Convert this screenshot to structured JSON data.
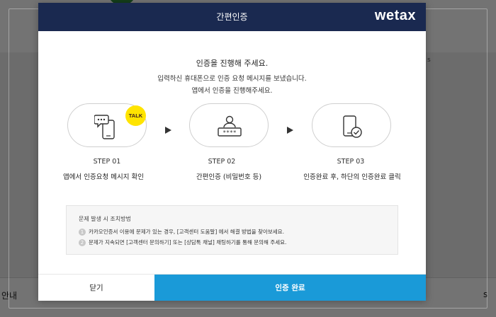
{
  "background": {
    "side_text": "s",
    "bottom_left_text": "안내",
    "bottom_right_text": "s"
  },
  "modal": {
    "title": "간편인증",
    "logo": "wetax",
    "heading": "인증을 진행해 주세요.",
    "description_line1": "입력하신 휴대폰으로 인증 요청 메시지를 보냈습니다.",
    "description_line2": "앱에서 인증을 진행해주세요."
  },
  "steps": [
    {
      "label": "STEP 01",
      "description": "앱에서 인증요청 메시지 확인",
      "icon": "phone-message-icon",
      "badge": "TALK"
    },
    {
      "label": "STEP 02",
      "description": "간편인증 (비밀번호 등)",
      "icon": "password-user-icon"
    },
    {
      "label": "STEP 03",
      "description": "인증완료 후, 하단의 인증완료 클릭",
      "icon": "phone-check-icon"
    }
  ],
  "info": {
    "title": "문제 발생 시 조치방법",
    "items": [
      {
        "num": "1",
        "text": "카카오인증서 이용에 문제가 있는 경우, [고객센터 도움말] 에서 해결 방법을 찾아보세요."
      },
      {
        "num": "2",
        "text": "문제가 지속되면 [고객센터 문의하기] 또는 [상담톡 채널] 채팅하기를 통해 문의해 주세요."
      }
    ]
  },
  "buttons": {
    "close": "닫기",
    "complete": "인증 완료"
  },
  "colors": {
    "header": "#1a2950",
    "primary": "#1a9ad8",
    "talk_badge": "#ffe400"
  }
}
